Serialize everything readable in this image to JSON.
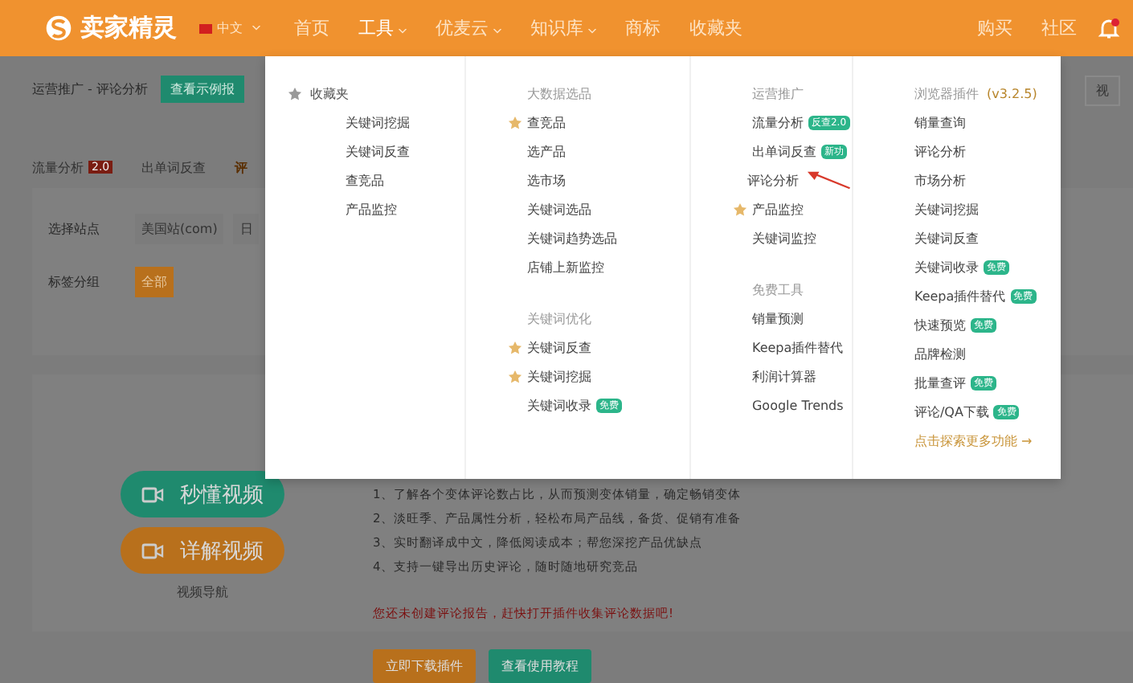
{
  "header": {
    "logo": "卖家精灵",
    "language": "中文",
    "nav": [
      {
        "label": "首页",
        "dropdown": false,
        "selected": false
      },
      {
        "label": "工具",
        "dropdown": true,
        "selected": true
      },
      {
        "label": "优麦云",
        "dropdown": true,
        "selected": false
      },
      {
        "label": "知识库",
        "dropdown": true,
        "selected": false
      },
      {
        "label": "商标",
        "dropdown": false,
        "selected": false
      },
      {
        "label": "收藏夹",
        "dropdown": false,
        "selected": false
      }
    ],
    "right_links": [
      "购买",
      "社区"
    ]
  },
  "page": {
    "breadcrumb": "运营推广 - 评论分析",
    "sample_button": "查看示例报",
    "right_button": "视",
    "tabs": [
      {
        "label": "流量分析",
        "badge": "2.0",
        "selected": false
      },
      {
        "label": "出单词反查",
        "selected": false
      },
      {
        "label": "评",
        "selected": true
      }
    ],
    "filters": [
      {
        "label": "选择站点",
        "options": [
          {
            "label": "美国站(com)",
            "selected": false
          },
          {
            "label": "日",
            "selected": false
          }
        ]
      },
      {
        "label": "标签分组",
        "options": [
          {
            "label": "全部",
            "selected": true
          }
        ]
      }
    ],
    "video_buttons": [
      {
        "label": "秒懂视频",
        "color": "#1f8a6e"
      },
      {
        "label": "详解视频",
        "color": "#b8701c"
      }
    ],
    "video_nav": "视频导航",
    "features": [
      "1、了解各个变体评论数占比，从而预测变体销量，确定畅销变体",
      "2、淡旺季、产品属性分析，轻松布局产品线，备货、促销有准备",
      "3、实时翻译成中文，降低阅读成本；帮您深挖产品优缺点",
      "4、支持一键导出历史评论，随时随地研究竞品"
    ],
    "notice": "您还未创建评论报告，赶快打开插件收集评论数据吧!",
    "buttons": [
      {
        "label": "立即下载插件",
        "color": "#b8701c"
      },
      {
        "label": "查看使用教程",
        "color": "#1f8a6e"
      }
    ]
  },
  "menu": {
    "columns": [
      {
        "groups": [
          {
            "heading": "收藏夹",
            "heading_star": true,
            "items": [
              {
                "label": "关键词挖掘",
                "starred": false
              },
              {
                "label": "关键词反查",
                "starred": false
              },
              {
                "label": "查竞品",
                "starred": false
              },
              {
                "label": "产品监控",
                "starred": false
              }
            ]
          }
        ]
      },
      {
        "groups": [
          {
            "heading": "大数据选品",
            "heading_star": false,
            "items": [
              {
                "label": "查竞品",
                "starred": true
              },
              {
                "label": "选产品",
                "starred": false
              },
              {
                "label": "选市场",
                "starred": false
              },
              {
                "label": "关键词选品",
                "starred": false
              },
              {
                "label": "关键词趋势选品",
                "starred": false
              },
              {
                "label": "店铺上新监控",
                "starred": false
              }
            ]
          },
          {
            "heading": "关键词优化",
            "heading_star": false,
            "items": [
              {
                "label": "关键词反查",
                "starred": true
              },
              {
                "label": "关键词挖掘",
                "starred": true
              },
              {
                "label": "关键词收录",
                "starred": false,
                "badge": "免费"
              }
            ]
          }
        ]
      },
      {
        "groups": [
          {
            "heading": "运营推广",
            "heading_star": false,
            "items": [
              {
                "label": "流量分析",
                "starred": false,
                "badge": "反查2.0"
              },
              {
                "label": "出单词反查",
                "starred": false,
                "badge": "新功"
              },
              {
                "label": "评论分析",
                "starred": false,
                "pointer": true
              },
              {
                "label": "产品监控",
                "starred": true
              },
              {
                "label": "关键词监控",
                "starred": false
              }
            ]
          },
          {
            "heading": "免费工具",
            "heading_star": false,
            "items": [
              {
                "label": "销量预测",
                "starred": false
              },
              {
                "label": "Keepa插件替代",
                "starred": false
              },
              {
                "label": "利润计算器",
                "starred": false
              },
              {
                "label": "Google Trends",
                "starred": false
              }
            ]
          }
        ]
      },
      {
        "groups": [
          {
            "heading": "浏览器插件",
            "version": "(v3.2.5)",
            "heading_star": false,
            "items": [
              {
                "label": "销量查询",
                "starred": false
              },
              {
                "label": "评论分析",
                "starred": false
              },
              {
                "label": "市场分析",
                "starred": false
              },
              {
                "label": "关键词挖掘",
                "starred": false
              },
              {
                "label": "关键词反查",
                "starred": false
              },
              {
                "label": "关键词收录",
                "starred": false,
                "badge": "免费"
              },
              {
                "label": "Keepa插件替代",
                "starred": false,
                "badge": "免费"
              },
              {
                "label": "快速预览",
                "starred": false,
                "badge": "免费"
              },
              {
                "label": "品牌检测",
                "starred": false
              },
              {
                "label": "批量查评",
                "starred": false,
                "badge": "免费"
              },
              {
                "label": "评论/QA下载",
                "starred": false,
                "badge": "免费"
              }
            ],
            "more_link": "点击探索更多功能 →"
          }
        ]
      }
    ]
  }
}
